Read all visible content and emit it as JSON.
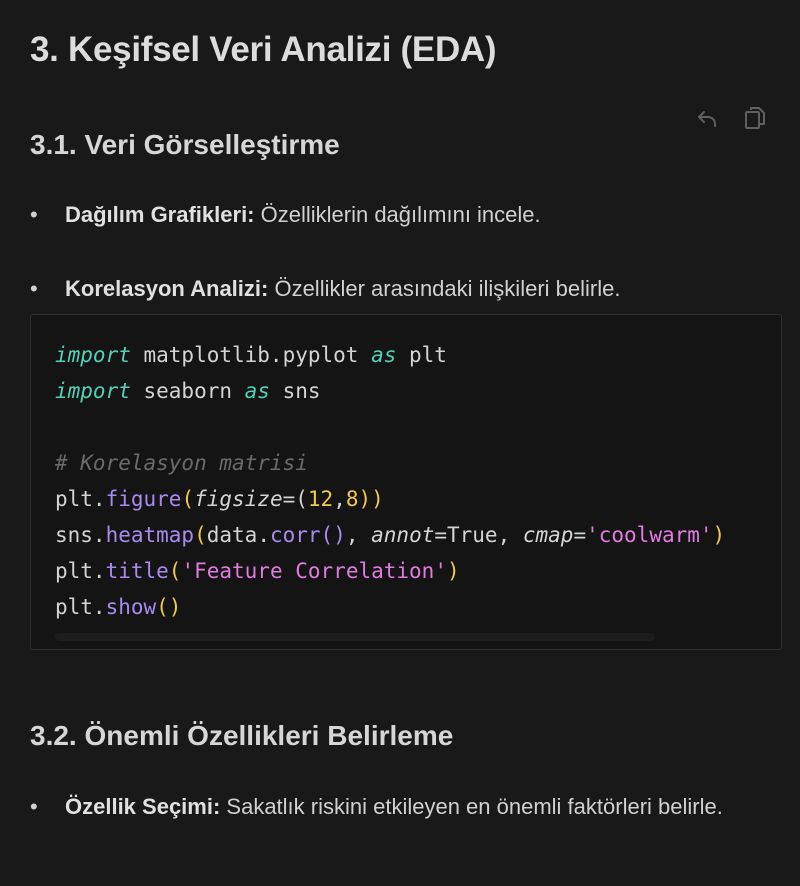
{
  "heading_main": "3. Keşifsel Veri Analizi (EDA)",
  "section1": {
    "title": "3.1. Veri Görselleştirme",
    "bullets": [
      {
        "label": "Dağılım Grafikleri:",
        "text": " Özelliklerin dağılımını incele."
      },
      {
        "label": "Korelasyon Analizi:",
        "text": " Özellikler arasındaki ilişkileri belirle."
      }
    ]
  },
  "toolbar": {
    "icons": [
      "undo-icon",
      "copy-icon"
    ]
  },
  "code": {
    "language": "python",
    "lines": [
      [
        {
          "t": "import",
          "c": "kw"
        },
        {
          "t": " matplotlib.pyplot ",
          "c": ""
        },
        {
          "t": "as",
          "c": "kw"
        },
        {
          "t": " plt",
          "c": ""
        }
      ],
      [
        {
          "t": "import",
          "c": "kw"
        },
        {
          "t": " seaborn ",
          "c": ""
        },
        {
          "t": "as",
          "c": "kw"
        },
        {
          "t": " sns",
          "c": ""
        }
      ],
      [],
      [
        {
          "t": "# Korelasyon matrisi",
          "c": "cm"
        }
      ],
      [
        {
          "t": "plt.",
          "c": ""
        },
        {
          "t": "figure",
          "c": "fn"
        },
        {
          "t": "(",
          "c": "pr"
        },
        {
          "t": "figsize",
          "c": "pm"
        },
        {
          "t": "=(",
          "c": ""
        },
        {
          "t": "12",
          "c": "nm"
        },
        {
          "t": ",",
          "c": ""
        },
        {
          "t": "8",
          "c": "nm"
        },
        {
          "t": "))",
          "c": "pr"
        }
      ],
      [
        {
          "t": "sns.",
          "c": ""
        },
        {
          "t": "heatmap",
          "c": "fn"
        },
        {
          "t": "(",
          "c": "pr"
        },
        {
          "t": "data.",
          "c": ""
        },
        {
          "t": "corr",
          "c": "fn"
        },
        {
          "t": "()",
          "c": "fn"
        },
        {
          "t": ", ",
          "c": ""
        },
        {
          "t": "annot",
          "c": "pm"
        },
        {
          "t": "=True, ",
          "c": ""
        },
        {
          "t": "cmap",
          "c": "pm"
        },
        {
          "t": "=",
          "c": ""
        },
        {
          "t": "'coolwarm'",
          "c": "st"
        },
        {
          "t": ")",
          "c": "pr"
        }
      ],
      [
        {
          "t": "plt.",
          "c": ""
        },
        {
          "t": "title",
          "c": "fn"
        },
        {
          "t": "(",
          "c": "pr"
        },
        {
          "t": "'Feature Correlation'",
          "c": "st"
        },
        {
          "t": ")",
          "c": "pr"
        }
      ],
      [
        {
          "t": "plt.",
          "c": ""
        },
        {
          "t": "show",
          "c": "fn"
        },
        {
          "t": "()",
          "c": "pr"
        }
      ]
    ]
  },
  "section2": {
    "title": "3.2. Önemli Özellikleri Belirleme",
    "bullets": [
      {
        "label": "Özellik Seçimi:",
        "text": " Sakatlık riskini etkileyen en önemli faktörleri belirle."
      }
    ]
  }
}
